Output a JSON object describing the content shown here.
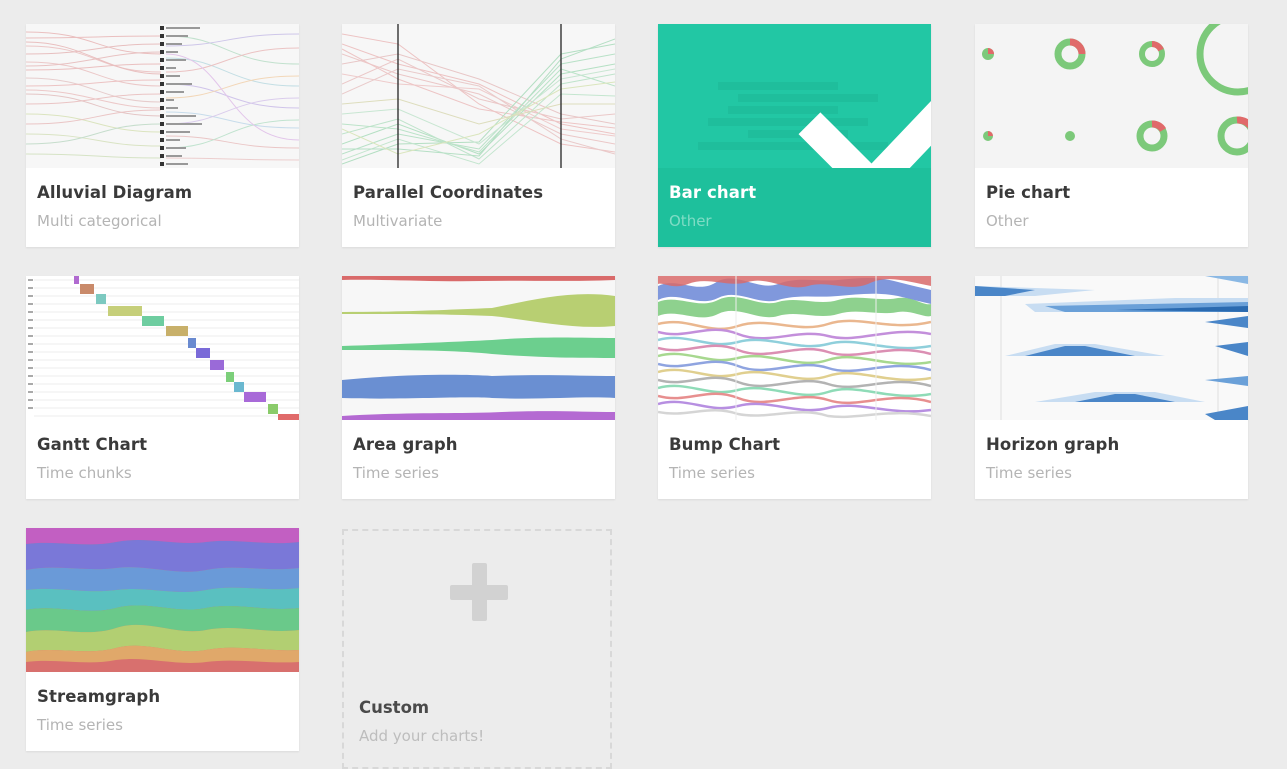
{
  "charts": [
    {
      "title": "Alluvial Diagram",
      "category": "Multi categorical",
      "thumbnail_icon": "alluvial-diagram-thumbnail",
      "selected": false
    },
    {
      "title": "Parallel Coordinates",
      "category": "Multivariate",
      "thumbnail_icon": "parallel-coordinates-thumbnail",
      "selected": false
    },
    {
      "title": "Bar chart",
      "category": "Other",
      "thumbnail_icon": "bar-chart-thumbnail",
      "selected": true
    },
    {
      "title": "Pie chart",
      "category": "Other",
      "thumbnail_icon": "pie-chart-thumbnail",
      "selected": false
    },
    {
      "title": "Gantt Chart",
      "category": "Time chunks",
      "thumbnail_icon": "gantt-chart-thumbnail",
      "selected": false
    },
    {
      "title": "Area graph",
      "category": "Time series",
      "thumbnail_icon": "area-graph-thumbnail",
      "selected": false
    },
    {
      "title": "Bump Chart",
      "category": "Time series",
      "thumbnail_icon": "bump-chart-thumbnail",
      "selected": false
    },
    {
      "title": "Horizon graph",
      "category": "Time series",
      "thumbnail_icon": "horizon-graph-thumbnail",
      "selected": false
    },
    {
      "title": "Streamgraph",
      "category": "Time series",
      "thumbnail_icon": "streamgraph-thumbnail",
      "selected": false
    }
  ],
  "custom": {
    "title": "Custom",
    "subtitle": "Add your charts!",
    "icon": "plus-icon"
  },
  "selected_icon": "checkmark-icon",
  "colors": {
    "background": "#ececec",
    "selected": "#1ec09c",
    "card": "#ffffff",
    "title_text": "#3a3a3a",
    "category_text": "#b4b4b4"
  }
}
